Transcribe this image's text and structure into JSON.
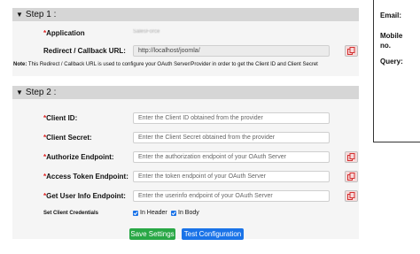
{
  "step1": {
    "title": "Step 1 :",
    "application_label": "Application",
    "application_value": "SalesForce",
    "redirect_label": "Redirect / Callback URL:",
    "redirect_value": "http://localhost/joomla/",
    "note_prefix": "Note:",
    "note_text": " This Redirect / Callback URL is used to configure your OAuth Server/Provider in order to get the Client ID and Client Secret"
  },
  "step2": {
    "title": "Step 2 :",
    "fields": [
      {
        "label": "Client ID:",
        "placeholder": "Enter the Client ID obtained from the provider"
      },
      {
        "label": "Client Secret:",
        "placeholder": "Enter the Client Secret obtained from the provider"
      },
      {
        "label": "Authorize Endpoint:",
        "placeholder": "Enter the authorization endpoint of your OAuth Server"
      },
      {
        "label": "Access Token Endpoint:",
        "placeholder": "Enter the token endpoint of your OAuth Server"
      },
      {
        "label": "Get User Info Endpoint:",
        "placeholder": "Enter the userinfo endpoint of your OAuth Server"
      }
    ],
    "credentials_label": "Set Client Credentials",
    "in_header_label": "In Header",
    "in_body_label": "In Body",
    "in_header_checked": true,
    "in_body_checked": true,
    "save_label": "Save Settings",
    "test_label": "Test Configuration"
  },
  "sidebar": {
    "email_label": "Email:",
    "mobile_label_1": "Mobile",
    "mobile_label_2": "no.",
    "query_label": "Query:"
  },
  "colors": {
    "save_button": "#28a745",
    "test_button": "#1a73e8",
    "copy_icon": "#d32f2f",
    "required": "#e02020"
  },
  "req_mark": "*"
}
